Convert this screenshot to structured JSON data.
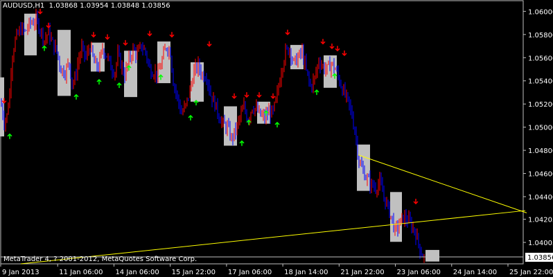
{
  "window": {
    "symbol_timeframe": "AUDUSD,H1",
    "ohlc": "1.03868 1.03954 1.03848 1.03856",
    "copyright": "MetaTrader 4, ? 2001-2012, MetaQuotes Software Corp."
  },
  "colors": {
    "background": "#000000",
    "frame": "#c0c0c0",
    "bull_bar": "#ff0000",
    "bear_bar": "#0000ff",
    "box": "#c0c0c0",
    "up_arrow": "#00ff00",
    "down_arrow": "#ff0000",
    "trendline": "#ffff00",
    "price_label_bg": "#ffffff",
    "price_label_text": "#000000"
  },
  "chart_data": {
    "type": "candlestick",
    "symbol": "AUDUSD",
    "timeframe": "H1",
    "ylim": [
      1.0382,
      1.0608
    ],
    "y_ticks": [
      "1.06000",
      "1.05800",
      "1.05600",
      "1.05400",
      "1.05200",
      "1.05000",
      "1.04800",
      "1.04600",
      "1.04400",
      "1.04205",
      "1.04005"
    ],
    "current_price": "1.03856",
    "x_ticks": [
      "9 Jan 2013",
      "11 Jan 06:00",
      "14 Jan 06:00",
      "15 Jan 22:00",
      "17 Jan 06:00",
      "18 Jan 14:00",
      "21 Jan 22:00",
      "23 Jan 06:00",
      "24 Jan 14:00",
      "25 Jan 22:00"
    ],
    "grid": false,
    "close_path": [
      [
        0,
        1.0525
      ],
      [
        6,
        1.0505
      ],
      [
        10,
        1.051
      ],
      [
        14,
        1.053
      ],
      [
        17,
        1.056
      ],
      [
        22,
        1.0575
      ],
      [
        30,
        1.0585
      ],
      [
        36,
        1.0582
      ],
      [
        44,
        1.059
      ],
      [
        52,
        1.0592
      ],
      [
        58,
        1.0585
      ],
      [
        64,
        1.0575
      ],
      [
        70,
        1.0582
      ],
      [
        76,
        1.0572
      ],
      [
        82,
        1.0565
      ],
      [
        88,
        1.055
      ],
      [
        94,
        1.0548
      ],
      [
        100,
        1.0556
      ],
      [
        104,
        1.0538
      ],
      [
        108,
        1.0541
      ],
      [
        112,
        1.0555
      ],
      [
        118,
        1.0568
      ],
      [
        124,
        1.056
      ],
      [
        130,
        1.057
      ],
      [
        136,
        1.0555
      ],
      [
        142,
        1.0552
      ],
      [
        148,
        1.0568
      ],
      [
        154,
        1.0562
      ],
      [
        160,
        1.0552
      ],
      [
        166,
        1.0548
      ],
      [
        170,
        1.0562
      ],
      [
        176,
        1.0552
      ],
      [
        180,
        1.0545
      ],
      [
        186,
        1.0558
      ],
      [
        192,
        1.0567
      ],
      [
        198,
        1.0563
      ],
      [
        204,
        1.057
      ],
      [
        210,
        1.0565
      ],
      [
        216,
        1.055
      ],
      [
        222,
        1.0548
      ],
      [
        228,
        1.0545
      ],
      [
        234,
        1.0558
      ],
      [
        240,
        1.057
      ],
      [
        246,
        1.0565
      ],
      [
        250,
        1.054
      ],
      [
        256,
        1.0525
      ],
      [
        262,
        1.0512
      ],
      [
        268,
        1.0518
      ],
      [
        274,
        1.0532
      ],
      [
        280,
        1.0548
      ],
      [
        286,
        1.0553
      ],
      [
        292,
        1.0545
      ],
      [
        298,
        1.0545
      ],
      [
        304,
        1.0528
      ],
      [
        310,
        1.052
      ],
      [
        316,
        1.051
      ],
      [
        322,
        1.0502
      ],
      [
        328,
        1.05
      ],
      [
        334,
        1.049
      ],
      [
        340,
        1.0497
      ],
      [
        346,
        1.0508
      ],
      [
        352,
        1.0517
      ],
      [
        358,
        1.0507
      ],
      [
        364,
        1.0518
      ],
      [
        370,
        1.0515
      ],
      [
        376,
        1.051
      ],
      [
        382,
        1.0508
      ],
      [
        388,
        1.0513
      ],
      [
        394,
        1.0512
      ],
      [
        400,
        1.0528
      ],
      [
        406,
        1.055
      ],
      [
        412,
        1.0565
      ],
      [
        418,
        1.0568
      ],
      [
        424,
        1.0555
      ],
      [
        430,
        1.056
      ],
      [
        436,
        1.0565
      ],
      [
        442,
        1.0548
      ],
      [
        448,
        1.0535
      ],
      [
        454,
        1.0542
      ],
      [
        460,
        1.0558
      ],
      [
        466,
        1.0552
      ],
      [
        472,
        1.055
      ],
      [
        478,
        1.0555
      ],
      [
        484,
        1.055
      ],
      [
        490,
        1.054
      ],
      [
        496,
        1.053
      ],
      [
        502,
        1.0522
      ],
      [
        508,
        1.051
      ],
      [
        514,
        1.049
      ],
      [
        518,
        1.047
      ],
      [
        524,
        1.0462
      ],
      [
        530,
        1.0455
      ],
      [
        536,
        1.045
      ],
      [
        542,
        1.0448
      ],
      [
        548,
        1.0452
      ],
      [
        554,
        1.044
      ],
      [
        560,
        1.043
      ],
      [
        566,
        1.042
      ],
      [
        570,
        1.041
      ],
      [
        576,
        1.0416
      ],
      [
        582,
        1.0422
      ],
      [
        588,
        1.042
      ],
      [
        594,
        1.0415
      ],
      [
        600,
        1.0408
      ],
      [
        606,
        1.0395
      ],
      [
        612,
        1.0387
      ]
    ],
    "highlight_boxes": [
      {
        "from": 0,
        "to": 6,
        "high": 1.0543,
        "low": 1.0492
      },
      {
        "from": 35,
        "to": 53,
        "high": 1.0598,
        "low": 1.0562
      },
      {
        "from": 83,
        "to": 102,
        "high": 1.0584,
        "low": 1.0527
      },
      {
        "from": 131,
        "to": 151,
        "high": 1.0573,
        "low": 1.0548
      },
      {
        "from": 179,
        "to": 198,
        "high": 1.0566,
        "low": 1.0526
      },
      {
        "from": 227,
        "to": 246,
        "high": 1.0574,
        "low": 1.0538
      },
      {
        "from": 275,
        "to": 294,
        "high": 1.0556,
        "low": 1.0522
      },
      {
        "from": 323,
        "to": 342,
        "high": 1.0518,
        "low": 1.0484
      },
      {
        "from": 371,
        "to": 390,
        "high": 1.0522,
        "low": 1.0503
      },
      {
        "from": 419,
        "to": 438,
        "high": 1.0571,
        "low": 1.055
      },
      {
        "from": 467,
        "to": 486,
        "high": 1.0562,
        "low": 1.0534
      },
      {
        "from": 515,
        "to": 534,
        "high": 1.0485,
        "low": 1.0445
      },
      {
        "from": 563,
        "to": 580,
        "high": 1.0444,
        "low": 1.0401
      },
      {
        "from": 614,
        "to": 634,
        "high": 1.0394,
        "low": 1.0384
      }
    ],
    "down_signals": [
      [
        6,
        1.0521
      ],
      [
        58,
        1.0598
      ],
      [
        70,
        1.0586
      ],
      [
        135,
        1.0578
      ],
      [
        155,
        1.0576
      ],
      [
        181,
        1.0571
      ],
      [
        216,
        1.0579
      ],
      [
        248,
        1.0578
      ],
      [
        302,
        1.057
      ],
      [
        338,
        1.0525
      ],
      [
        356,
        1.0526
      ],
      [
        374,
        1.0526
      ],
      [
        394,
        1.0525
      ],
      [
        415,
        1.058
      ],
      [
        466,
        1.0572
      ],
      [
        479,
        1.0568
      ],
      [
        487,
        1.0566
      ],
      [
        497,
        1.0562
      ],
      [
        600,
        1.0434
      ]
    ],
    "up_signals": [
      [
        14,
        1.0494
      ],
      [
        64,
        1.057
      ],
      [
        110,
        1.0528
      ],
      [
        143,
        1.0541
      ],
      [
        172,
        1.0538
      ],
      [
        186,
        1.0553
      ],
      [
        232,
        1.0545
      ],
      [
        275,
        1.051
      ],
      [
        283,
        1.0523
      ],
      [
        349,
        1.0488
      ],
      [
        359,
        1.0506
      ],
      [
        384,
        1.0514
      ],
      [
        400,
        1.0504
      ],
      [
        457,
        1.0532
      ],
      [
        483,
        1.0546
      ]
    ],
    "trendlines": [
      {
        "from": [
          517,
          1.0476
        ],
        "to": [
          760,
          1.0426
        ]
      },
      {
        "from": [
          30,
          1.0382
        ],
        "to": [
          758,
          1.0428
        ]
      }
    ]
  }
}
